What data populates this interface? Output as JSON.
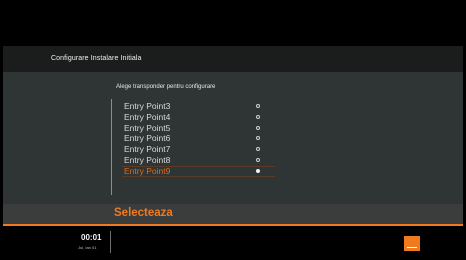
{
  "header": {
    "title": "Configurare Instalare Initiala"
  },
  "panel": {
    "subtitle": "Alege transponder pentru configurare",
    "items": [
      {
        "label": "Entry Point3",
        "selected": false
      },
      {
        "label": "Entry Point4",
        "selected": false
      },
      {
        "label": "Entry Point5",
        "selected": false
      },
      {
        "label": "Entry Point6",
        "selected": false
      },
      {
        "label": "Entry Point7",
        "selected": false
      },
      {
        "label": "Entry Point8",
        "selected": false
      },
      {
        "label": "Entry Point9",
        "selected": true
      }
    ]
  },
  "action": {
    "label": "Selecteaza"
  },
  "footer": {
    "time": "00:01",
    "date": "Joi, Ian 01"
  },
  "colors": {
    "accent": "#f07a1f",
    "panel": "#2f3434",
    "header": "#1b1d1d"
  },
  "icons": {
    "brand": "orange-logo-icon",
    "radio": "radio-circle-icon"
  }
}
